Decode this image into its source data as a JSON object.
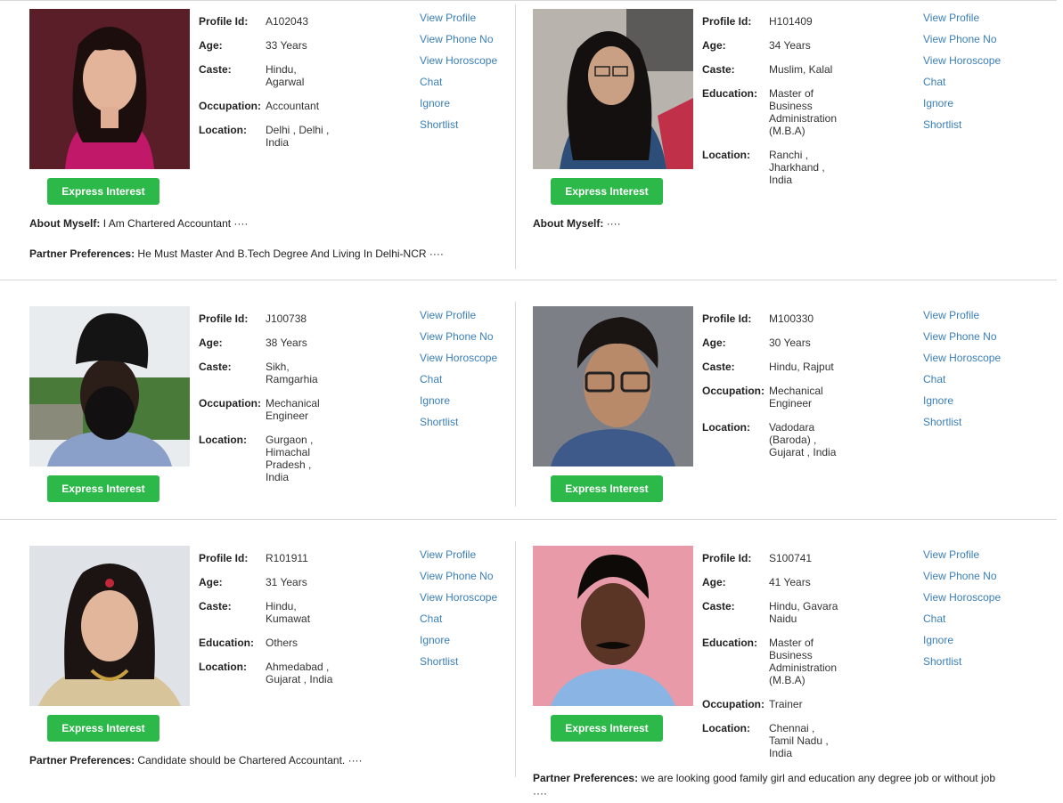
{
  "labels": {
    "profile_id": "Profile Id:",
    "age": "Age:",
    "caste": "Caste:",
    "occupation": "Occupation:",
    "education": "Education:",
    "location": "Location:",
    "about_myself": "About Myself:",
    "partner_preferences": "Partner Preferences:"
  },
  "actions": {
    "view_profile": "View Profile",
    "view_phone": "View Phone No",
    "view_horoscope": "View Horoscope",
    "chat": "Chat",
    "ignore": "Ignore",
    "shortlist": "Shortlist",
    "express_interest": "Express Interest"
  },
  "profiles": [
    {
      "id": "A102043",
      "age": "33 Years",
      "caste": "Hindu, Agarwal",
      "occupation": "Accountant",
      "location": "Delhi , Delhi , India",
      "about": "I Am Chartered Accountant ····",
      "partner": "He Must Master And B.Tech Degree And Living In Delhi-NCR ····"
    },
    {
      "id": "H101409",
      "age": "34 Years",
      "caste": "Muslim, Kalal",
      "education": "Master of Business Administration (M.B.A)",
      "location": "Ranchi , Jharkhand , India",
      "about": "····"
    },
    {
      "id": "J100738",
      "age": "38 Years",
      "caste": "Sikh, Ramgarhia",
      "occupation": "Mechanical Engineer",
      "location": "Gurgaon , Himachal Pradesh , India"
    },
    {
      "id": "M100330",
      "age": "30 Years",
      "caste": "Hindu, Rajput",
      "occupation": "Mechanical Engineer",
      "location": "Vadodara (Baroda) , Gujarat , India"
    },
    {
      "id": "R101911",
      "age": "31 Years",
      "caste": "Hindu, Kumawat",
      "education": "Others",
      "location": "Ahmedabad , Gujarat , India",
      "partner": "Candidate should be Chartered Accountant. ····"
    },
    {
      "id": "S100741",
      "age": "41 Years",
      "caste": "Hindu, Gavara Naidu",
      "education": "Master of Business Administration (M.B.A)",
      "occupation": "Trainer",
      "location": "Chennai , Tamil Nadu , India",
      "partner": "we are looking good family girl and education any degree job or without job ····"
    }
  ]
}
